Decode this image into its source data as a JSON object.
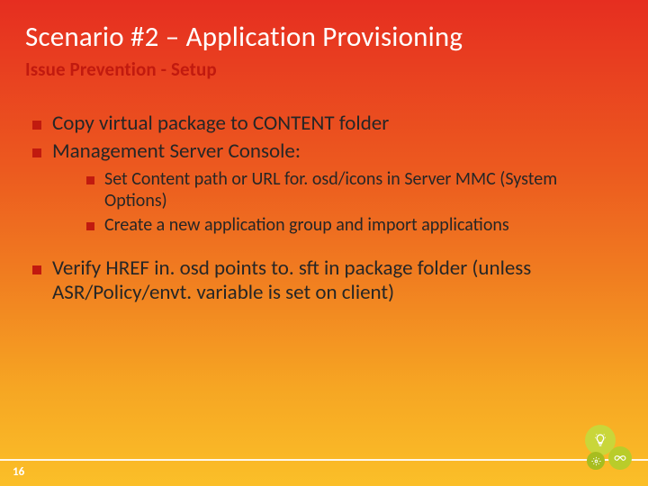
{
  "title": "Scenario #2 – Application Provisioning",
  "subtitle": "Issue Prevention - Setup",
  "bullets": {
    "b1": "Copy virtual package to CONTENT folder",
    "b2": "Management Server Console:",
    "b2_1": "Set Content path or URL for. osd/icons in Server MMC (System Options)",
    "b2_2": "Create a new application group and import applications",
    "b3": "Verify HREF in. osd points to. sft in package folder (unless ASR/Policy/envt. variable is set on client)"
  },
  "page_number": "16",
  "icons": {
    "bulb": "lightbulb-icon",
    "gear": "gear-icon",
    "infinity": "infinity-icon"
  }
}
